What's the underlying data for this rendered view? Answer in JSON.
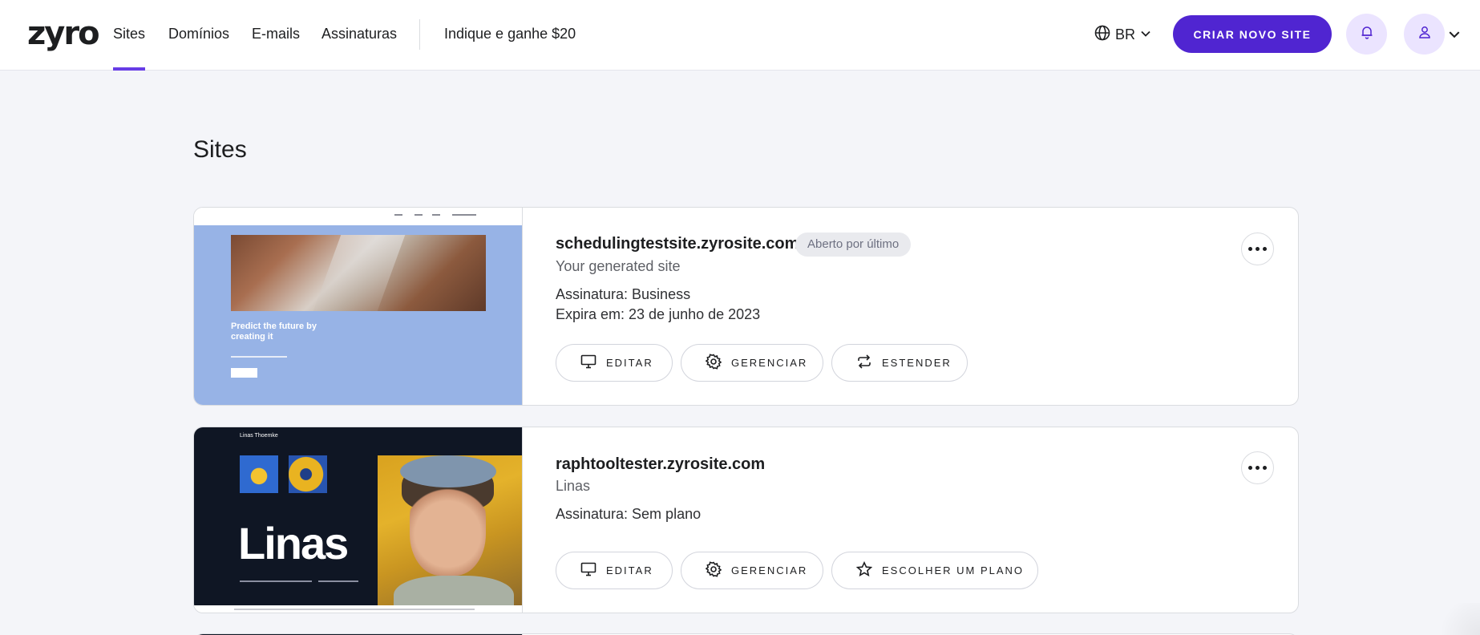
{
  "header": {
    "logo": "zyro",
    "nav": {
      "sites": "Sites",
      "domains": "Domínios",
      "emails": "E-mails",
      "subscriptions": "Assinaturas",
      "referral": "Indique e ganhe $20"
    },
    "language": "BR",
    "create_button": "CRIAR NOVO SITE",
    "accent_color": "#5025d1"
  },
  "main": {
    "title": "Sites",
    "sites": [
      {
        "domain": "schedulingtestsite.zyrosite.com",
        "badge": "Aberto por último",
        "name": "Your generated site",
        "subscription": "Assinatura: Business",
        "expires": "Expira em: 23 de junho de 2023",
        "thumbnail_heading": "Predict the future by creating it",
        "actions": {
          "edit": "EDITAR",
          "manage": "GERENCIAR",
          "extend": "ESTENDER"
        }
      },
      {
        "domain": "raphtooltester.zyrosite.com",
        "name": "Linas",
        "subscription": "Assinatura: Sem plano",
        "thumbnail_brand": "Linas Thoemke",
        "thumbnail_title": "Linas",
        "actions": {
          "edit": "EDITAR",
          "manage": "GERENCIAR",
          "choose_plan": "ESCOLHER UM PLANO"
        }
      }
    ]
  }
}
